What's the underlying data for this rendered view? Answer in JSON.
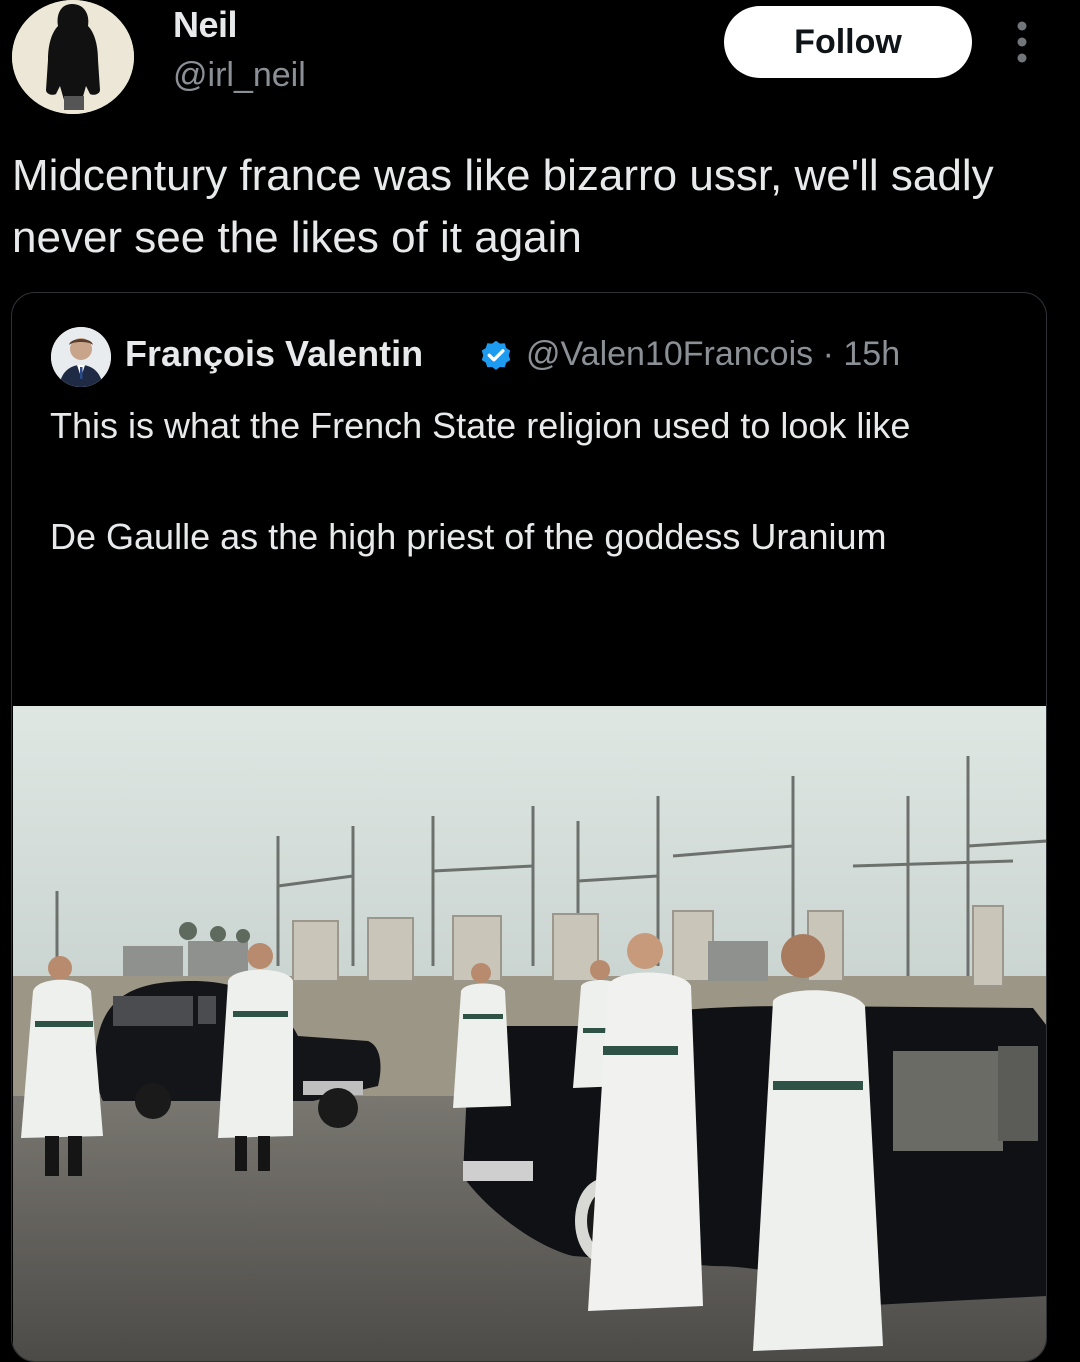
{
  "post": {
    "author_name": "Neil",
    "author_handle": "@irl_neil",
    "follow_label": "Follow",
    "text": "Midcentury france was like bizarro ussr, we'll sadly never see the likes of it again"
  },
  "quoted_post": {
    "author_name": "François Valentin",
    "author_handle": "@Valen10Francois",
    "separator": "·",
    "time": "15h",
    "verified": true,
    "text_line_1": "This is what the French State religion used to look like",
    "text_line_2": "De Gaulle as the high priest of the goddess Uranium"
  },
  "colors": {
    "background": "#000000",
    "text_primary": "#e7e9ea",
    "text_secondary": "#8b9096",
    "verified_blue": "#1d9bf0",
    "follow_bg": "#ffffff"
  },
  "icons": {
    "more": "more-vertical-icon",
    "verified": "verified-badge-icon"
  }
}
